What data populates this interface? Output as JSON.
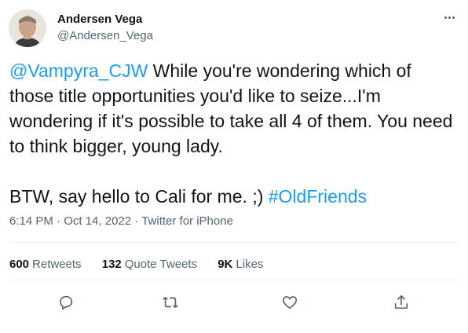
{
  "author": {
    "display_name": "Andersen Vega",
    "handle": "@Andersen_Vega"
  },
  "tweet": {
    "mention": "@Vampyra_CJW",
    "text_part1": " While you're wondering which of those title opportunities you'd like to seize...I'm wondering if it's possible to take all 4 of them. You need to think bigger, young lady.\n\nBTW, say hello to Cali for me. ;) ",
    "hashtag": "#OldFriends"
  },
  "meta": {
    "time": "6:14 PM",
    "sep1": " · ",
    "date": "Oct 14, 2022",
    "sep2": " · ",
    "source": "Twitter for iPhone"
  },
  "stats": {
    "retweets_count": "600",
    "retweets_label": "Retweets",
    "quotes_count": "132",
    "quotes_label": "Quote Tweets",
    "likes_count": "9K",
    "likes_label": "Likes"
  },
  "icons": {
    "reply": "reply-icon",
    "retweet": "retweet-icon",
    "like": "heart-icon",
    "share": "share-icon",
    "more": "more-icon"
  },
  "colors": {
    "link": "#1d9bf0",
    "muted": "#536471",
    "text": "#0f1419"
  }
}
